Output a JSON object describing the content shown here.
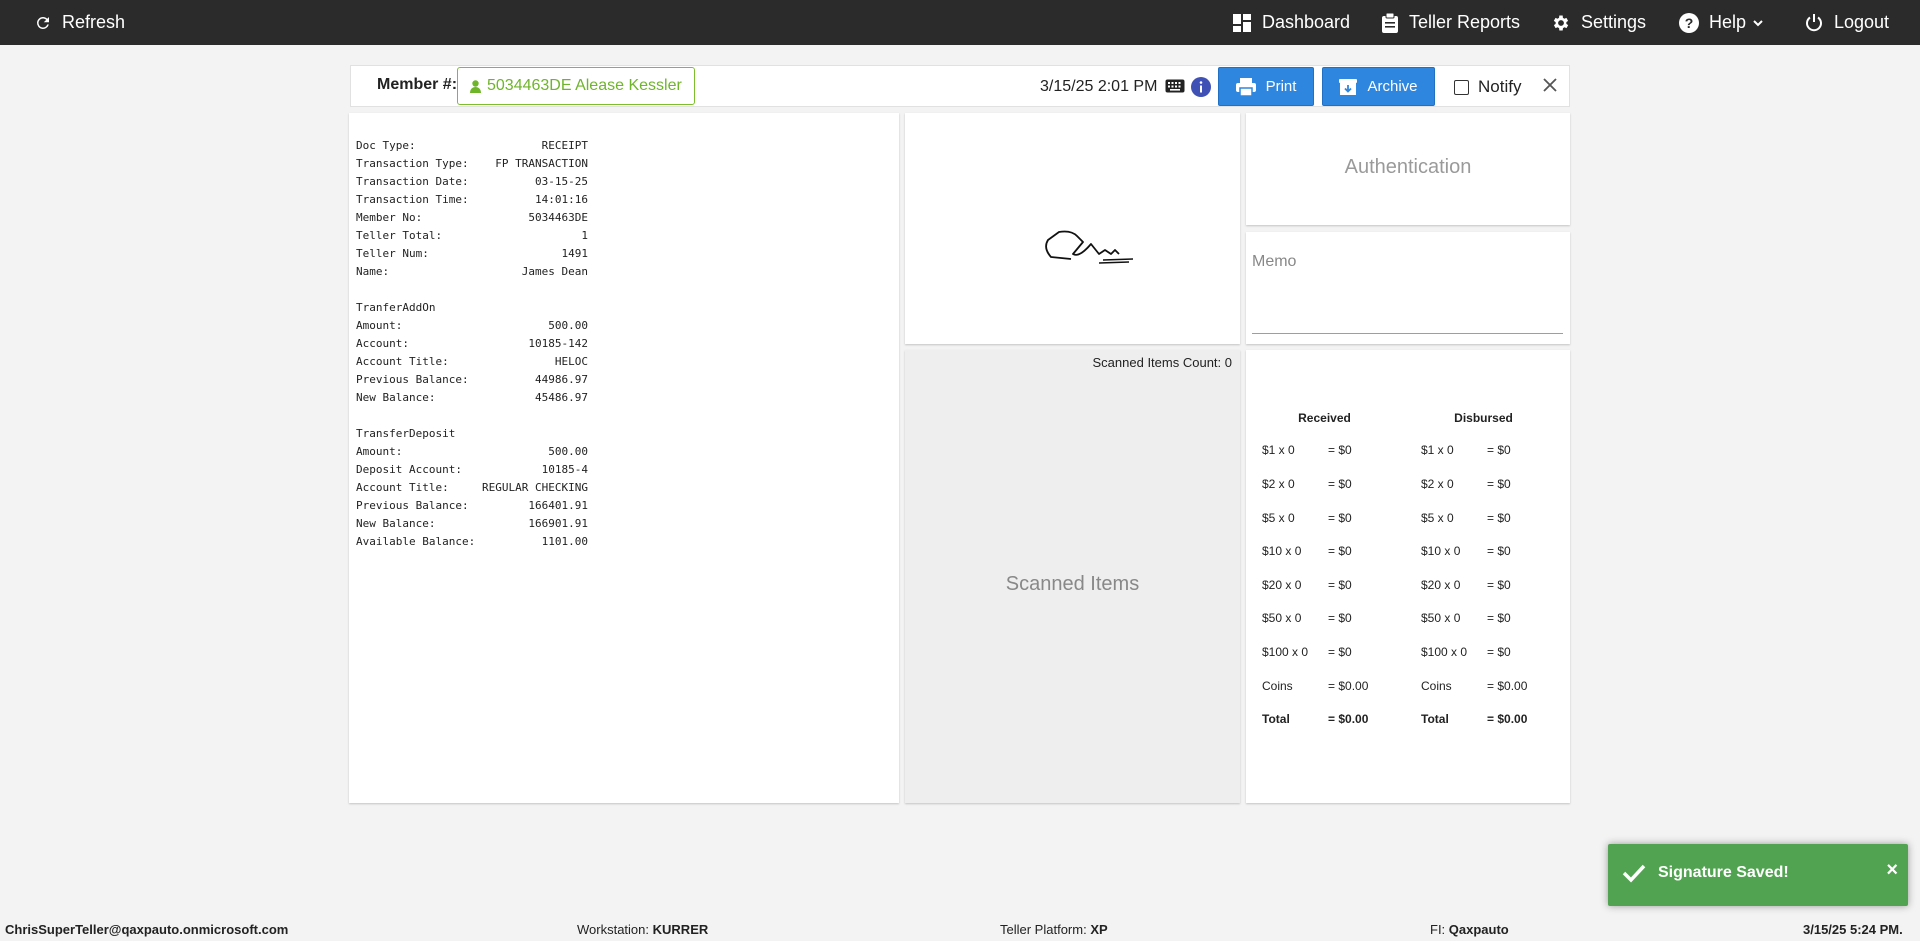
{
  "topbar": {
    "refresh": "Refresh",
    "dashboard": "Dashboard",
    "teller_reports": "Teller Reports",
    "settings": "Settings",
    "help": "Help",
    "logout": "Logout"
  },
  "member": {
    "label": "Member #:",
    "value": "5034463DE Alease Kessler",
    "datetime": "3/15/25 2:01 PM",
    "print_label": "Print",
    "archive_label": "Archive",
    "notify_label": "Notify"
  },
  "receipt": {
    "section1": [
      [
        "Doc Type:",
        "RECEIPT"
      ],
      [
        "Transaction Type:",
        "FP TRANSACTION"
      ],
      [
        "Transaction Date:",
        "03-15-25"
      ],
      [
        "Transaction Time:",
        "14:01:16"
      ],
      [
        "Member No:",
        "5034463DE"
      ],
      [
        "Teller Total:",
        "1"
      ],
      [
        "Teller Num:",
        "1491"
      ],
      [
        "Name:",
        "James Dean"
      ]
    ],
    "section2_title": "TranferAddOn",
    "section2": [
      [
        "Amount:",
        "500.00"
      ],
      [
        "Account:",
        "10185-142"
      ],
      [
        "Account Title:",
        "HELOC"
      ],
      [
        "Previous Balance:",
        "44986.97"
      ],
      [
        "New Balance:",
        "45486.97"
      ]
    ],
    "section3_title": "TransferDeposit",
    "section3": [
      [
        "Amount:",
        "500.00"
      ],
      [
        "Deposit Account:",
        "10185-4"
      ],
      [
        "Account Title:",
        "REGULAR CHECKING"
      ],
      [
        "Previous Balance:",
        "166401.91"
      ],
      [
        "New Balance:",
        "166901.91"
      ],
      [
        "Available Balance:",
        "1101.00"
      ]
    ]
  },
  "scanned": {
    "count_label": "Scanned Items Count: 0",
    "title": "Scanned Items"
  },
  "auth": {
    "title": "Authentication"
  },
  "memo": {
    "label": "Memo"
  },
  "cash": {
    "received_header": "Received",
    "disbursed_header": "Disbursed",
    "received": [
      [
        "$1 x 0",
        "= $0"
      ],
      [
        "$2 x 0",
        "= $0"
      ],
      [
        "$5 x 0",
        "= $0"
      ],
      [
        "$10 x 0",
        "= $0"
      ],
      [
        "$20 x 0",
        "= $0"
      ],
      [
        "$50 x 0",
        "= $0"
      ],
      [
        "$100 x 0",
        "= $0"
      ],
      [
        "Coins",
        "= $0.00"
      ],
      [
        "Total",
        "= $0.00"
      ]
    ],
    "disbursed": [
      [
        "$1 x 0",
        "= $0"
      ],
      [
        "$2 x 0",
        "= $0"
      ],
      [
        "$5 x 0",
        "= $0"
      ],
      [
        "$10 x 0",
        "= $0"
      ],
      [
        "$20 x 0",
        "= $0"
      ],
      [
        "$50 x 0",
        "= $0"
      ],
      [
        "$100 x 0",
        "= $0"
      ],
      [
        "Coins",
        "= $0.00"
      ],
      [
        "Total",
        "= $0.00"
      ]
    ]
  },
  "toast": {
    "message": "Signature Saved!",
    "close": "×"
  },
  "footer": {
    "user": "ChrisSuperTeller@qaxpauto.onmicrosoft.com",
    "workstation_label": "Workstation:",
    "workstation": "KURRER",
    "platform_label": "Teller Platform:",
    "platform": "XP",
    "fi_label": "FI:",
    "fi": "Qaxpauto",
    "datetime": "3/15/25 5:24 PM."
  },
  "colors": {
    "topbar": "#2b2b2b",
    "accent_blue": "#2f86de",
    "member_green": "#6fb52a",
    "toast_green": "#51a351"
  }
}
